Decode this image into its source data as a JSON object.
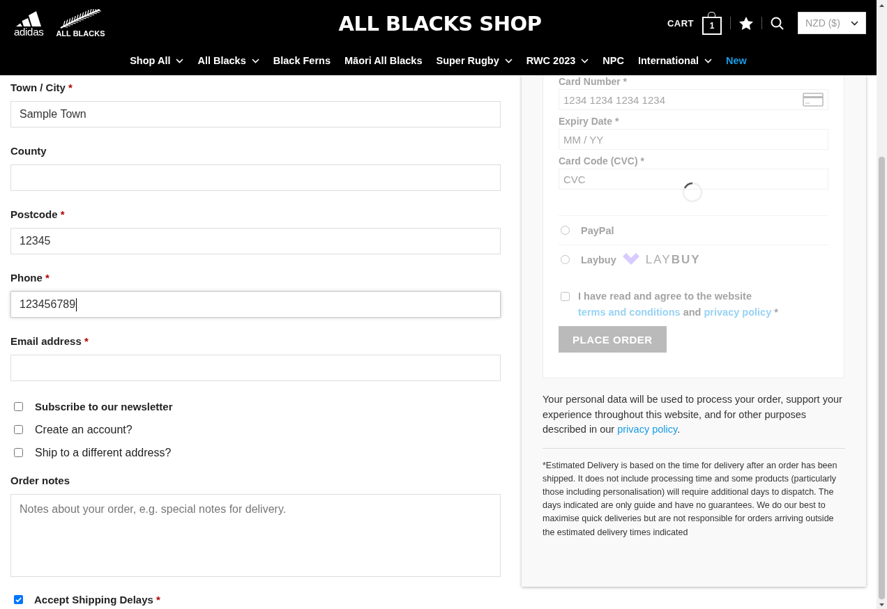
{
  "header": {
    "logos": [
      {
        "kind": "stripes",
        "text": "adidas"
      },
      {
        "kind": "fern",
        "text": "ALL BLACKS"
      }
    ],
    "title": "ALL BLACKS SHOP",
    "cart": {
      "label": "CART",
      "count": "1"
    },
    "currency": "NZD ($)",
    "nav": [
      {
        "label": "Shop All",
        "has_menu": true,
        "highlighted": false
      },
      {
        "label": "All Blacks",
        "has_menu": true,
        "highlighted": false
      },
      {
        "label": "Black Ferns",
        "has_menu": false,
        "highlighted": false
      },
      {
        "label": "Māori All Blacks",
        "has_menu": false,
        "highlighted": false
      },
      {
        "label": "Super Rugby",
        "has_menu": true,
        "highlighted": false
      },
      {
        "label": "RWC 2023",
        "has_menu": true,
        "highlighted": false
      },
      {
        "label": "NPC",
        "has_menu": false,
        "highlighted": false
      },
      {
        "label": "International",
        "has_menu": true,
        "highlighted": false
      },
      {
        "label": "New",
        "has_menu": false,
        "highlighted": true
      }
    ]
  },
  "billing_fields": [
    {
      "label": "Town / City",
      "required_mark": "*",
      "value": "Sample Town",
      "focused": false
    },
    {
      "label": "County",
      "focused": false
    },
    {
      "label": "Postcode",
      "required_mark": "*",
      "value": "12345",
      "focused": false
    },
    {
      "label": "Phone",
      "required_mark": "*",
      "value": "123456789",
      "focused": true
    },
    {
      "label": "Email address",
      "required_mark": "*",
      "focused": false
    }
  ],
  "options": [
    {
      "label": "Subscribe to our newsletter",
      "checked": false,
      "emphasized": true
    },
    {
      "label": "Create an account?",
      "checked": false,
      "emphasized": false
    },
    {
      "label": "Ship to a different address?",
      "checked": false,
      "emphasized": false
    }
  ],
  "order_notes": {
    "label": "Order notes",
    "placeholder": "Notes about your order, e.g. special notes for delivery."
  },
  "shipping_delays": {
    "label": "Accept Shipping Delays",
    "required_mark": "*",
    "checked": true
  },
  "payment": {
    "loading": true,
    "card_fields": [
      {
        "label": "Card Number",
        "required_mark": "*",
        "placeholder": "1234 1234 1234 1234",
        "kind": "card"
      },
      {
        "label": "Expiry Date",
        "required_mark": "*",
        "placeholder": "MM / YY",
        "kind": "plain"
      },
      {
        "label": "Card Code (CVC)",
        "required_mark": "*",
        "placeholder": "CVC",
        "kind": "plain"
      }
    ],
    "methods": [
      {
        "name": "PayPal",
        "selected": false,
        "kind": "plain"
      },
      {
        "name": "Laybuy",
        "selected": false,
        "kind": "laybuy",
        "logo_text": "LAY**BUY**"
      }
    ],
    "terms": {
      "checked": false,
      "parts": [
        {
          "text": "I have read and agree to the website ",
          "link": false
        },
        {
          "text": "terms and conditions",
          "link": true
        },
        {
          "text": " and ",
          "link": false
        },
        {
          "text": "privacy policy",
          "link": true
        },
        {
          "text": " *",
          "link": false
        }
      ]
    },
    "button": "PLACE ORDER"
  },
  "privacy_notice": {
    "parts": [
      {
        "text": "Your personal data will be used to process your order, support your experience throughout this website, and for other purposes described in our ",
        "link": false
      },
      {
        "text": "privacy policy",
        "link": true
      },
      {
        "text": ".",
        "link": false
      }
    ]
  },
  "disclaimer": "*Estimated Delivery is based on the time for delivery after an order has been shipped. It does not include processing time and some products (particularly those including personalisation) will require additional days to dispatch. The days indicated are only guide and have no guarantees. We do our best to maximise quick deliveries but are not responsible for orders arriving outside the estimated delivery times indicated"
}
